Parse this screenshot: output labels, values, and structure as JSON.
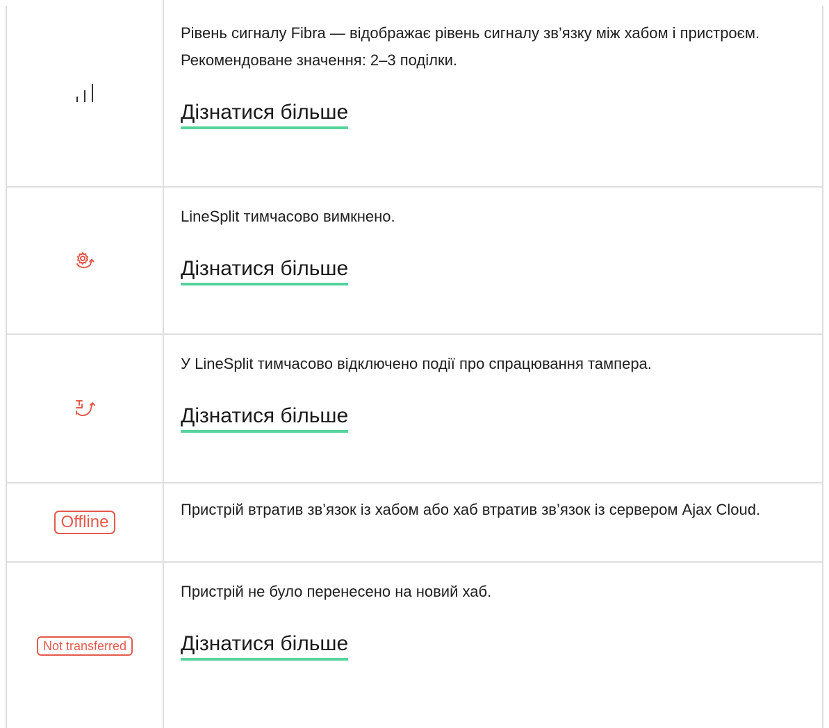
{
  "rows": [
    {
      "description": "Рівень сигналу Fibra — відображає рівень сигналу зв’язку між хабом і пристроєм. Рекомендоване значення: 2–3 поділки.",
      "link": "Дізнатися більше",
      "icon": "signal-strength-icon"
    },
    {
      "description": "LineSplit тимчасово вимкнено.",
      "link": "Дізнатися більше",
      "icon": "gear-rotate-icon"
    },
    {
      "description": "У LineSplit тимчасово відключено події про спрацювання тампера.",
      "link": "Дізнатися більше",
      "icon": "tamper-off-icon"
    },
    {
      "description": "Пристрій втратив зв’язок із хабом або хаб втратив зв’язок із сервером Ajax Cloud.",
      "badge": "Offline"
    },
    {
      "description": "Пристрій не було перенесено на новий хаб.",
      "link": "Дізнатися більше",
      "badge": "Not transferred"
    }
  ],
  "colors": {
    "accent_red": "#e55a4c",
    "link_underline": "#56d39d",
    "border": "#dedede"
  }
}
